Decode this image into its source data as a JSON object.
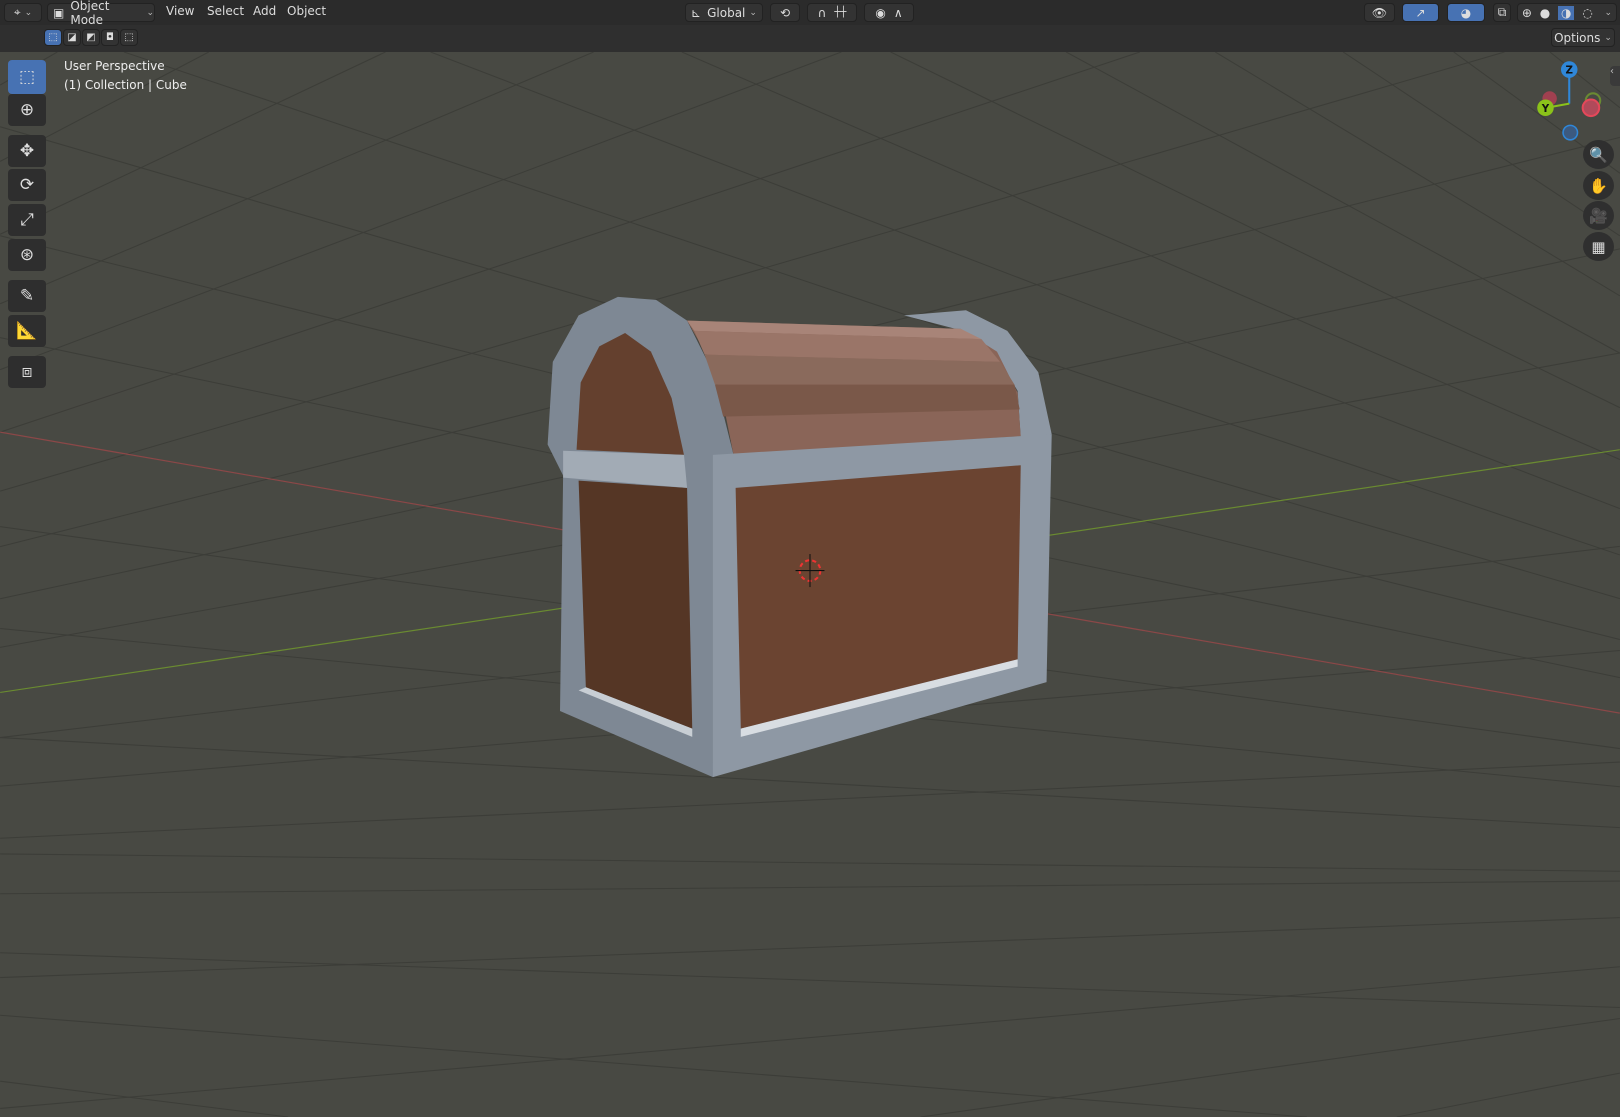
{
  "header": {
    "editor_type_icon": "3d-viewport-icon",
    "mode": "Object Mode",
    "menus": [
      "View",
      "Select",
      "Add",
      "Object"
    ],
    "transform_orientation": "Global",
    "options_label": "Options"
  },
  "select_modes": [
    "set",
    "extend",
    "subtract",
    "difference",
    "intersect"
  ],
  "viewport": {
    "view_name": "User Perspective",
    "object_info": "(1) Collection | Cube"
  },
  "tools": [
    "select-box",
    "cursor",
    "move",
    "rotate",
    "scale",
    "transform",
    "annotate",
    "measure",
    "add-cube"
  ],
  "gizmo": {
    "z": "Z",
    "y": "Y",
    "x": "X",
    "colors": {
      "x": "#e4485a",
      "y": "#8bc21a",
      "z": "#2f87d9"
    }
  },
  "nav_buttons": [
    "zoom",
    "pan",
    "camera",
    "ortho-grid"
  ],
  "colors": {
    "viewport_bg": "#484943",
    "accent": "#4772b3",
    "frame": "#8a94a0",
    "wood": "#6b4431"
  }
}
